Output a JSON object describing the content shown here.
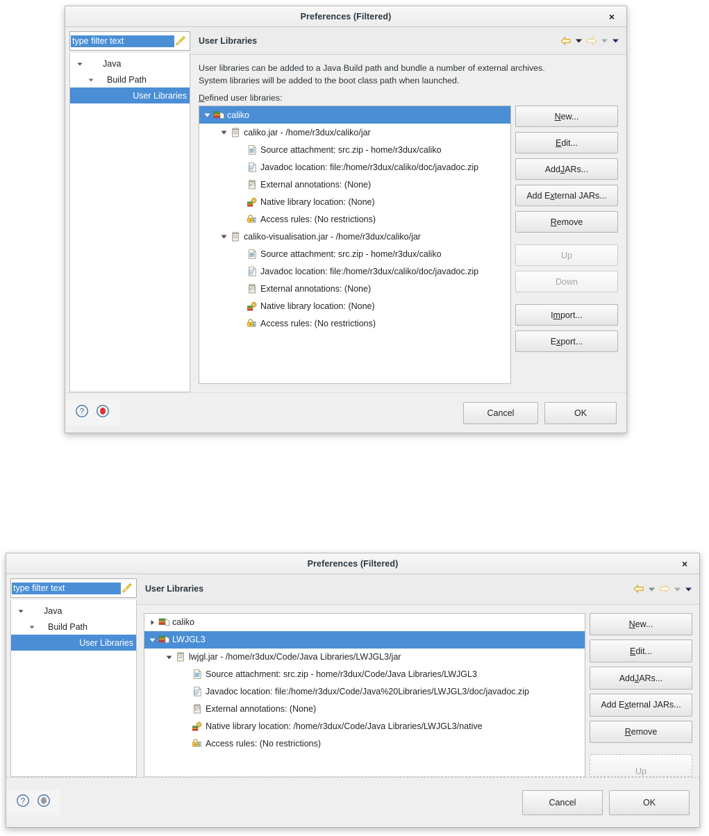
{
  "dialog1": {
    "title": "Preferences (Filtered)",
    "close_label": "×",
    "filter": {
      "value": "type filter text",
      "placeholder": "type filter text",
      "broom_icon": "broom-icon"
    },
    "nav": [
      {
        "label": "Java",
        "twisty": "chevron-down-icon",
        "selected": false,
        "indent": 0
      },
      {
        "label": "Build Path",
        "twisty": "chevron-down-icon",
        "selected": false,
        "indent": 1
      },
      {
        "label": "User Libraries",
        "twisty": "",
        "selected": true,
        "indent": 2
      }
    ],
    "pane_title": "User Libraries",
    "nav_icons": [
      "back-arrow-icon",
      "back-dropdown-icon",
      "forward-arrow-icon",
      "forward-dropdown-icon",
      "menu-dropdown-icon"
    ],
    "description_line1": "User libraries can be added to a Java Build path and bundle a number of external archives.",
    "description_line2": "System libraries will be added to the boot class path when launched.",
    "defined_label_mnemonic": "D",
    "defined_label_rest": "efined user libraries:",
    "tree": [
      {
        "label": "caliko",
        "icon": "library-icon",
        "twisty": "chevron-down-icon",
        "indent": 0,
        "selected": true
      },
      {
        "label": "caliko.jar - /home/r3dux/caliko/jar",
        "icon": "jar-icon",
        "twisty": "chevron-down-icon",
        "indent": 1,
        "selected": false
      },
      {
        "label": "Source attachment: src.zip - home/r3dux/caliko",
        "icon": "source-attachment-icon",
        "twisty": "",
        "indent": 2,
        "selected": false
      },
      {
        "label": "Javadoc location: file:/home/r3dux/caliko/doc/javadoc.zip",
        "icon": "javadoc-icon",
        "twisty": "",
        "indent": 2,
        "selected": false
      },
      {
        "label": "External annotations: (None)",
        "icon": "external-annotations-icon",
        "twisty": "",
        "indent": 2,
        "selected": false
      },
      {
        "label": "Native library location: (None)",
        "icon": "native-library-icon",
        "twisty": "",
        "indent": 2,
        "selected": false
      },
      {
        "label": "Access rules: (No restrictions)",
        "icon": "access-rules-icon",
        "twisty": "",
        "indent": 2,
        "selected": false
      },
      {
        "label": "caliko-visualisation.jar - /home/r3dux/caliko/jar",
        "icon": "jar-icon",
        "twisty": "chevron-down-icon",
        "indent": 1,
        "selected": false
      },
      {
        "label": "Source attachment: src.zip - home/r3dux/caliko",
        "icon": "source-attachment-icon",
        "twisty": "",
        "indent": 2,
        "selected": false
      },
      {
        "label": "Javadoc location: file:/home/r3dux/caliko/doc/javadoc.zip",
        "icon": "javadoc-icon",
        "twisty": "",
        "indent": 2,
        "selected": false
      },
      {
        "label": "External annotations: (None)",
        "icon": "external-annotations-icon",
        "twisty": "",
        "indent": 2,
        "selected": false
      },
      {
        "label": "Native library location: (None)",
        "icon": "native-library-icon",
        "twisty": "",
        "indent": 2,
        "selected": false
      },
      {
        "label": "Access rules: (No restrictions)",
        "icon": "access-rules-icon",
        "twisty": "",
        "indent": 2,
        "selected": false
      }
    ],
    "buttons": [
      {
        "mnemonic": "N",
        "pre": "",
        "post": "ew...",
        "disabled": false,
        "gap_after": false
      },
      {
        "mnemonic": "E",
        "pre": "",
        "post": "dit...",
        "disabled": false,
        "gap_after": false
      },
      {
        "mnemonic": "J",
        "pre": "Add ",
        "post": "ARs...",
        "disabled": false,
        "gap_after": false
      },
      {
        "mnemonic": "x",
        "pre": "Add E",
        "post": "ternal JARs...",
        "disabled": false,
        "gap_after": false
      },
      {
        "mnemonic": "R",
        "pre": "",
        "post": "emove",
        "disabled": false,
        "gap_after": true
      },
      {
        "mnemonic": "",
        "pre": "Up",
        "post": "",
        "disabled": true,
        "gap_after": false
      },
      {
        "mnemonic": "",
        "pre": "Down",
        "post": "",
        "disabled": true,
        "gap_after": true
      },
      {
        "mnemonic": "m",
        "pre": "I",
        "post": "port...",
        "disabled": false,
        "gap_after": false
      },
      {
        "mnemonic": "x",
        "pre": "E",
        "post": "port...",
        "disabled": false,
        "gap_after": false
      }
    ],
    "footer": {
      "help_icon": "help-icon",
      "record_icon": "record-icon",
      "record_color": "#e03131",
      "cancel_label": "Cancel",
      "ok_label": "OK"
    }
  },
  "dialog2": {
    "title": "Preferences (Filtered)",
    "close_label": "×",
    "filter": {
      "value": "type filter text",
      "placeholder": "type filter text",
      "broom_icon": "broom-icon"
    },
    "nav": [
      {
        "label": "Java",
        "twisty": "chevron-down-icon",
        "selected": false,
        "indent": 0
      },
      {
        "label": "Build Path",
        "twisty": "chevron-down-icon",
        "selected": false,
        "indent": 1
      },
      {
        "label": "User Libraries",
        "twisty": "",
        "selected": true,
        "indent": 2
      }
    ],
    "pane_title": "User Libraries",
    "nav_icons": [
      "back-arrow-icon",
      "back-dropdown-icon",
      "forward-arrow-icon",
      "forward-dropdown-icon",
      "menu-dropdown-icon"
    ],
    "tree": [
      {
        "label": "caliko",
        "icon": "library-icon",
        "twisty": "chevron-right-icon",
        "indent": 0,
        "selected": false
      },
      {
        "label": "LWJGL3",
        "icon": "library-icon",
        "twisty": "chevron-down-icon",
        "indent": 0,
        "selected": true
      },
      {
        "label": "lwjgl.jar - /home/r3dux/Code/Java Libraries/LWJGL3/jar",
        "icon": "jar-icon",
        "twisty": "chevron-down-icon",
        "indent": 1,
        "selected": false
      },
      {
        "label": "Source attachment: src.zip - home/r3dux/Code/Java Libraries/LWJGL3",
        "icon": "source-attachment-icon",
        "twisty": "",
        "indent": 2,
        "selected": false
      },
      {
        "label": "Javadoc location: file:/home/r3dux/Code/Java%20Libraries/LWJGL3/doc/javadoc.zip",
        "icon": "javadoc-icon",
        "twisty": "",
        "indent": 2,
        "selected": false
      },
      {
        "label": "External annotations: (None)",
        "icon": "external-annotations-icon",
        "twisty": "",
        "indent": 2,
        "selected": false
      },
      {
        "label": "Native library location: /home/r3dux/Code/Java Libraries/LWJGL3/native",
        "icon": "native-library-icon",
        "twisty": "",
        "indent": 2,
        "selected": false
      },
      {
        "label": "Access rules: (No restrictions)",
        "icon": "access-rules-icon",
        "twisty": "",
        "indent": 2,
        "selected": false
      }
    ],
    "buttons": [
      {
        "mnemonic": "N",
        "pre": "",
        "post": "ew...",
        "disabled": false,
        "gap_after": false
      },
      {
        "mnemonic": "E",
        "pre": "",
        "post": "dit...",
        "disabled": false,
        "gap_after": false
      },
      {
        "mnemonic": "J",
        "pre": "Add ",
        "post": "ARs...",
        "disabled": false,
        "gap_after": false
      },
      {
        "mnemonic": "x",
        "pre": "Add E",
        "post": "ternal JARs...",
        "disabled": false,
        "gap_after": false
      },
      {
        "mnemonic": "R",
        "pre": "",
        "post": "emove",
        "disabled": false,
        "gap_after": true
      },
      {
        "mnemonic": "",
        "pre": "Up",
        "post": "",
        "disabled": true,
        "gap_after": false
      }
    ],
    "footer": {
      "help_icon": "help-icon",
      "record_icon": "record-icon",
      "record_color": "#9a9a9a",
      "cancel_label": "Cancel",
      "ok_label": "OK"
    }
  },
  "colors": {
    "selection_blue": "#4a8ed6",
    "dialog_bg": "#efefef",
    "pane_bg": "#ececec",
    "text": "#1d2226",
    "title_text": "#2a3740"
  }
}
